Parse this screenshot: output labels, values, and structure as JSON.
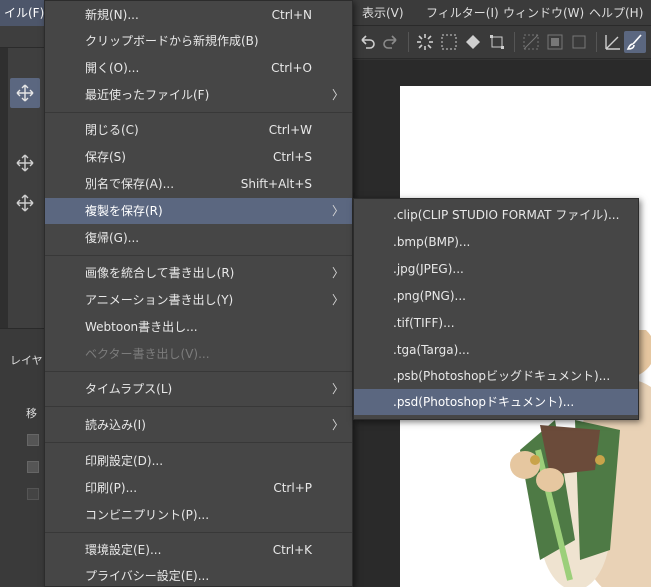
{
  "menubar": {
    "file_partial": "イル(F)",
    "view": "表示(V)",
    "filter": "フィルター(I)",
    "window": "ウィンドウ(W)",
    "help": "ヘルプ(H)"
  },
  "left_panel": {
    "layer_tab": "レイヤ",
    "move_label": "移"
  },
  "file_menu": {
    "items": [
      {
        "label": "新規(N)...",
        "shortcut": "Ctrl+N"
      },
      {
        "label": "クリップボードから新規作成(B)",
        "shortcut": ""
      },
      {
        "label": "開く(O)...",
        "shortcut": "Ctrl+O"
      },
      {
        "label": "最近使ったファイル(F)",
        "shortcut": ""
      },
      {
        "label": "閉じる(C)",
        "shortcut": "Ctrl+W"
      },
      {
        "label": "保存(S)",
        "shortcut": "Ctrl+S"
      },
      {
        "label": "別名で保存(A)...",
        "shortcut": "Shift+Alt+S"
      },
      {
        "label": "複製を保存(R)",
        "shortcut": ""
      },
      {
        "label": "復帰(G)...",
        "shortcut": ""
      },
      {
        "label": "画像を統合して書き出し(R)",
        "shortcut": ""
      },
      {
        "label": "アニメーション書き出し(Y)",
        "shortcut": ""
      },
      {
        "label": "Webtoon書き出し...",
        "shortcut": ""
      },
      {
        "label": "ベクター書き出し(V)...",
        "shortcut": ""
      },
      {
        "label": "タイムラプス(L)",
        "shortcut": ""
      },
      {
        "label": "読み込み(I)",
        "shortcut": ""
      },
      {
        "label": "印刷設定(D)...",
        "shortcut": ""
      },
      {
        "label": "印刷(P)...",
        "shortcut": "Ctrl+P"
      },
      {
        "label": "コンビニプリント(P)...",
        "shortcut": ""
      },
      {
        "label": "環境設定(E)...",
        "shortcut": "Ctrl+K"
      },
      {
        "label": "プライバシー設定(E)...",
        "shortcut": ""
      }
    ]
  },
  "save_copy_submenu": {
    "items": [
      {
        "label": ".clip(CLIP STUDIO FORMAT ファイル)..."
      },
      {
        "label": ".bmp(BMP)..."
      },
      {
        "label": ".jpg(JPEG)..."
      },
      {
        "label": ".png(PNG)..."
      },
      {
        "label": ".tif(TIFF)..."
      },
      {
        "label": ".tga(Targa)..."
      },
      {
        "label": ".psb(Photoshopビッグドキュメント)..."
      },
      {
        "label": ".psd(Photoshopドキュメント)..."
      }
    ]
  },
  "colors": {
    "menu_bg": "#464646",
    "highlight": "#5b6780",
    "disabled_text": "#7c7c7c"
  }
}
